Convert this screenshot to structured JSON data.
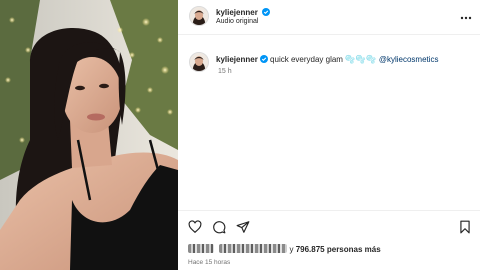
{
  "post": {
    "username": "kyliejenner",
    "audio": "Audio original",
    "caption_text": "quick everyday glam",
    "caption_emoji": "🫧🫧🫧",
    "caption_mention": "@kyliecosmetics",
    "caption_time": "15 h",
    "likes_prefix": "y",
    "likes_count": "796.875",
    "likes_suffix": "personas más",
    "posted_ago": "Hace 15 horas"
  },
  "icons": {
    "verified": "verified-badge-icon",
    "more": "more-options-icon",
    "like": "heart-icon",
    "comment": "comment-icon",
    "share": "share-icon",
    "save": "bookmark-icon"
  },
  "colors": {
    "verified_blue": "#0095f6",
    "mention_blue": "#00376b",
    "muted_text": "#737373"
  }
}
